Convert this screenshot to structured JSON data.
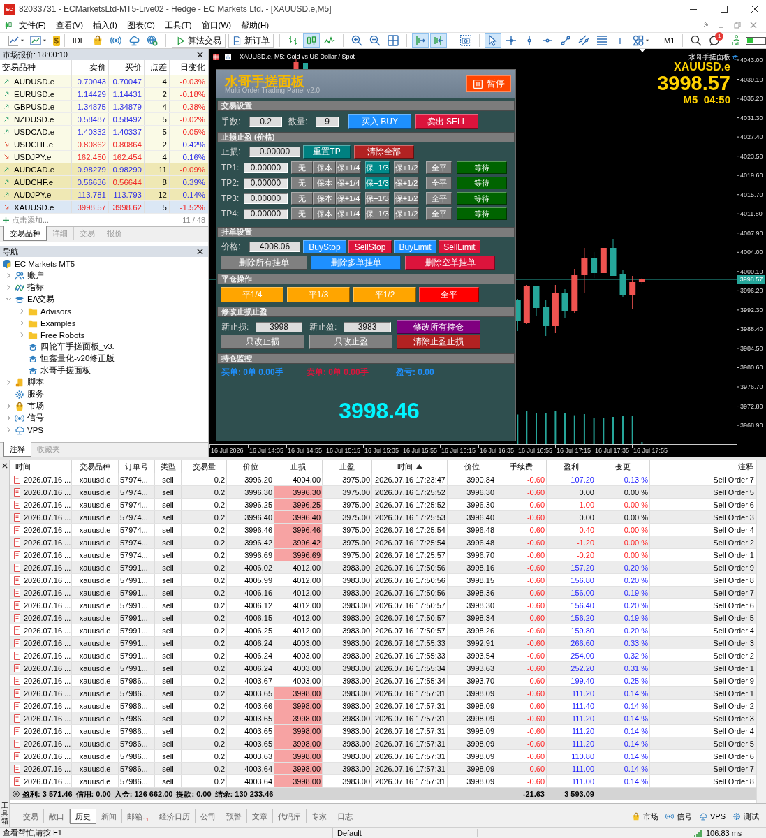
{
  "window": {
    "icon_label": "EC",
    "title": "82033731 - ECMarketsLtd-MT5-Live02 - Hedge - EC Markets Ltd. - [XAUUSD.e,M5]"
  },
  "menu": [
    "文件(F)",
    "查看(V)",
    "插入(I)",
    "图表(C)",
    "工具(T)",
    "窗口(W)",
    "帮助(H)"
  ],
  "toolbar": {
    "dollar": "$",
    "ide": "IDE",
    "algo_trading": "算法交易",
    "new_order": "新订单",
    "chart_types": [
      {
        "selected": false
      },
      {
        "selected": true
      },
      {
        "selected": false
      }
    ],
    "view_toggles": [
      {
        "on": true
      },
      {
        "on": true
      }
    ],
    "tools": [
      {
        "selected": true
      },
      {
        "selected": false
      },
      {
        "selected": false
      },
      {
        "selected": false
      },
      {
        "selected": false
      },
      {
        "selected": false
      },
      {
        "selected": false
      },
      {
        "label": "T",
        "selected": false
      },
      {
        "selected": false
      }
    ],
    "timeframe": "M1",
    "notifications": "1",
    "level_label": "LVL",
    "meter": {
      "level": 0.35
    }
  },
  "market_watch": {
    "title": "市场报价: 18:00:10",
    "columns": [
      "交易品种",
      "卖价",
      "买价",
      "点差",
      "日变化"
    ],
    "rows": [
      {
        "rising": true,
        "symbol": "AUDUSD.e",
        "bid": "0.70043",
        "bid_rising": true,
        "ask": "0.70047",
        "ask_rising": true,
        "spread": "4",
        "change": "-0.03%",
        "change_rising": false,
        "highlighted": false,
        "selected": false
      },
      {
        "rising": true,
        "symbol": "EURUSD.e",
        "bid": "1.14429",
        "bid_rising": true,
        "ask": "1.14431",
        "ask_rising": true,
        "spread": "2",
        "change": "-0.18%",
        "change_rising": false,
        "highlighted": false,
        "selected": false
      },
      {
        "rising": true,
        "symbol": "GBPUSD.e",
        "bid": "1.34875",
        "bid_rising": true,
        "ask": "1.34879",
        "ask_rising": true,
        "spread": "4",
        "change": "-0.38%",
        "change_rising": false,
        "highlighted": false,
        "selected": false
      },
      {
        "rising": true,
        "symbol": "NZDUSD.e",
        "bid": "0.58487",
        "bid_rising": true,
        "ask": "0.58492",
        "ask_rising": true,
        "spread": "5",
        "change": "-0.02%",
        "change_rising": false,
        "highlighted": false,
        "selected": false
      },
      {
        "rising": true,
        "symbol": "USDCAD.e",
        "bid": "1.40332",
        "bid_rising": true,
        "ask": "1.40337",
        "ask_rising": true,
        "spread": "5",
        "change": "-0.05%",
        "change_rising": false,
        "highlighted": false,
        "selected": false
      },
      {
        "rising": false,
        "symbol": "USDCHF.e",
        "bid": "0.80862",
        "bid_rising": false,
        "ask": "0.80864",
        "ask_rising": false,
        "spread": "2",
        "change": "0.42%",
        "change_rising": true,
        "highlighted": false,
        "selected": false
      },
      {
        "rising": false,
        "symbol": "USDJPY.e",
        "bid": "162.450",
        "bid_rising": false,
        "ask": "162.454",
        "ask_rising": false,
        "spread": "4",
        "change": "0.16%",
        "change_rising": true,
        "highlighted": false,
        "selected": false
      },
      {
        "rising": true,
        "symbol": "AUDCAD.e",
        "bid": "0.98279",
        "bid_rising": true,
        "ask": "0.98290",
        "ask_rising": true,
        "spread": "11",
        "change": "-0.09%",
        "change_rising": false,
        "highlighted": true,
        "selected": false
      },
      {
        "rising": true,
        "symbol": "AUDCHF.e",
        "bid": "0.56636",
        "bid_rising": true,
        "ask": "0.56644",
        "ask_rising": false,
        "spread": "8",
        "change": "0.39%",
        "change_rising": true,
        "highlighted": true,
        "selected": false
      },
      {
        "rising": true,
        "symbol": "AUDJPY.e",
        "bid": "113.781",
        "bid_rising": true,
        "ask": "113.793",
        "ask_rising": true,
        "spread": "12",
        "change": "0.14%",
        "change_rising": true,
        "highlighted": true,
        "selected": false
      },
      {
        "rising": false,
        "symbol": "XAUUSD.e",
        "bid": "3998.57",
        "bid_rising": false,
        "ask": "3998.62",
        "ask_rising": false,
        "spread": "5",
        "change": "-1.52%",
        "change_rising": false,
        "highlighted": false,
        "selected": true
      }
    ],
    "add_label": "点击添加...",
    "count": "11 / 48",
    "tabs": [
      {
        "label": "交易品种",
        "selected": true
      },
      {
        "label": "详细",
        "selected": false
      },
      {
        "label": "交易",
        "selected": false
      },
      {
        "label": "报价",
        "selected": false
      }
    ]
  },
  "navigator": {
    "title": "导航",
    "tree": [
      {
        "label": "EC Markets MT5",
        "kind": "broker",
        "children": [
          {
            "label": "账户",
            "kind": "accounts",
            "expanded": false
          },
          {
            "label": "指标",
            "kind": "indicators",
            "expanded": false
          },
          {
            "label": "EA交易",
            "kind": "experts",
            "expanded": true,
            "children": [
              {
                "label": "Advisors",
                "kind": "folder",
                "expanded": false
              },
              {
                "label": "Examples",
                "kind": "folder",
                "expanded": false
              },
              {
                "label": "Free Robots",
                "kind": "folder",
                "expanded": false
              },
              {
                "label": "四轮车手搓面板_v3.",
                "kind": "expert"
              },
              {
                "label": "恒鑫量化-v20修正版",
                "kind": "expert"
              },
              {
                "label": "水哥手搓面板",
                "kind": "expert"
              }
            ]
          },
          {
            "label": "脚本",
            "kind": "scripts",
            "expanded": false
          },
          {
            "label": "服务",
            "kind": "services"
          },
          {
            "label": "市场",
            "kind": "market",
            "expanded": false
          },
          {
            "label": "信号",
            "kind": "signals",
            "expanded": false
          },
          {
            "label": "VPS",
            "kind": "vps",
            "expanded": false
          }
        ]
      }
    ],
    "tabs": [
      {
        "label": "注释",
        "selected": true
      },
      {
        "label": "收藏夹",
        "selected": false
      }
    ]
  },
  "chart": {
    "symbol_line": "XAUUSD.e, M5: Gold vs US Dollar / Spot",
    "overlay": {
      "caption": "水哥手搓面板",
      "symbol": "XAUUSD.e",
      "price": "3998.57",
      "timer": "M5  04:50"
    },
    "price_axis": [
      "4043.00",
      "4039.10",
      "4035.20",
      "4031.30",
      "4027.40",
      "4023.50",
      "4019.60",
      "4015.70",
      "4011.80",
      "4007.90",
      "4004.00",
      "4000.10",
      "3996.20",
      "3992.30",
      "3988.40",
      "3984.50",
      "3980.60",
      "3976.70",
      "3972.80",
      "3968.90"
    ],
    "current_price": "3998.57",
    "time_axis": [
      "16 Jul 2026",
      "16 Jul 14:35",
      "16 Jul 14:55",
      "16 Jul 15:15",
      "16 Jul 15:35",
      "16 Jul 15:55",
      "16 Jul 16:15",
      "16 Jul 16:35",
      "16 Jul 16:55",
      "16 Jul 17:15",
      "16 Jul 17:35",
      "16 Jul 17:55"
    ]
  },
  "panel": {
    "title": "水哥手搓面板",
    "subtitle": "Multi-Order Trading Panel v2.0",
    "pause_button": {
      "label": "暂停",
      "color": "#ff4500"
    },
    "trade": {
      "title": "交易设置",
      "lots_label": "手数:",
      "lots": "0.2",
      "count_label": "数量:",
      "count": "9",
      "buttons": [
        {
          "label": "买入 BUY",
          "color": "#1e90ff"
        },
        {
          "label": "卖出 SELL",
          "color": "#dc143c"
        }
      ]
    },
    "sl_tp": {
      "title": "止损止盈 (价格)",
      "sl_label": "止损:",
      "sl": "0.00000",
      "buttons": [
        {
          "label": "重置TP",
          "color": "#008080"
        },
        {
          "label": "清除全部",
          "color": "#b22222"
        }
      ],
      "levels": [
        {
          "label": "TP1:",
          "value": "0.00000",
          "options": [
            {
              "label": "无",
              "selected": false
            },
            {
              "label": "保本",
              "selected": false
            },
            {
              "label": "保+1/4",
              "selected": false
            },
            {
              "label": "保+1/3",
              "selected": true
            },
            {
              "label": "保+1/2",
              "selected": false
            }
          ],
          "close_button": {
            "label": "全平",
            "color": "#808080"
          },
          "status_button": {
            "label": "等待",
            "color": "#006400"
          }
        },
        {
          "label": "TP2:",
          "value": "0.00000",
          "options": [
            {
              "label": "无",
              "selected": false
            },
            {
              "label": "保本",
              "selected": false
            },
            {
              "label": "保+1/4",
              "selected": false
            },
            {
              "label": "保+1/3",
              "selected": true
            },
            {
              "label": "保+1/2",
              "selected": false
            }
          ],
          "close_button": {
            "label": "全平",
            "color": "#808080"
          },
          "status_button": {
            "label": "等待",
            "color": "#006400"
          }
        },
        {
          "label": "TP3:",
          "value": "0.00000",
          "options": [
            {
              "label": "无",
              "selected": false
            },
            {
              "label": "保本",
              "selected": false
            },
            {
              "label": "保+1/4",
              "selected": false
            },
            {
              "label": "保+1/3",
              "selected": false
            },
            {
              "label": "保+1/2",
              "selected": false
            }
          ],
          "close_button": {
            "label": "全平",
            "color": "#808080"
          },
          "status_button": {
            "label": "等待",
            "color": "#006400"
          }
        },
        {
          "label": "TP4:",
          "value": "0.00000",
          "options": [
            {
              "label": "无",
              "selected": false
            },
            {
              "label": "保本",
              "selected": false
            },
            {
              "label": "保+1/4",
              "selected": false
            },
            {
              "label": "保+1/3",
              "selected": false
            },
            {
              "label": "保+1/2",
              "selected": false
            }
          ],
          "close_button": {
            "label": "全平",
            "color": "#808080"
          },
          "status_button": {
            "label": "等待",
            "color": "#006400"
          }
        }
      ]
    },
    "pending": {
      "title": "挂单设置",
      "price_label": "价格:",
      "price": "4008.06",
      "order_buttons": [
        {
          "label": "BuyStop",
          "color": "#1e90ff"
        },
        {
          "label": "SellStop",
          "color": "#dc143c"
        },
        {
          "label": "BuyLimit",
          "color": "#1e90ff"
        },
        {
          "label": "SellLimit",
          "color": "#dc143c"
        }
      ],
      "delete_buttons": [
        {
          "label": "删除所有挂单",
          "color": "#808080"
        },
        {
          "label": "删除多单挂单",
          "color": "#1e90ff"
        },
        {
          "label": "删除空单挂单",
          "color": "#dc143c"
        }
      ]
    },
    "close": {
      "title": "平仓操作",
      "buttons": [
        {
          "label": "平1/4",
          "color": "#ffa500"
        },
        {
          "label": "平1/3",
          "color": "#ffa500"
        },
        {
          "label": "平1/2",
          "color": "#ffa500"
        },
        {
          "label": "全平",
          "color": "#ff0000"
        }
      ]
    },
    "modify": {
      "title": "修改止损止盈",
      "sl_label": "新止损:",
      "sl": "3998",
      "tp_label": "新止盈:",
      "tp": "3983",
      "buttons": [
        {
          "label": "修改所有持仓",
          "color": "#800080"
        },
        {
          "label": "只改止损",
          "color": "#808080"
        },
        {
          "label": "只改止盈",
          "color": "#808080"
        },
        {
          "label": "清除止盈止损",
          "color": "#b22222"
        }
      ]
    },
    "monitor": {
      "title": "持仓监控",
      "stats": [
        {
          "text": "买单: 0单 0.00手",
          "color": "#1e90ff"
        },
        {
          "text": "卖单: 0单 0.00手",
          "color": "#dc143c"
        },
        {
          "text": "盈亏: 0.00",
          "color": "#1e90ff"
        }
      ],
      "price": "3998.46"
    }
  },
  "trades": {
    "columns": [
      {
        "label": "时间",
        "sorted": false
      },
      {
        "label": "交易品种",
        "sorted": false
      },
      {
        "label": "订单号",
        "sorted": false
      },
      {
        "label": "类型",
        "sorted": false
      },
      {
        "label": "交易量",
        "sorted": false
      },
      {
        "label": "价位",
        "sorted": false
      },
      {
        "label": "止损",
        "sorted": false
      },
      {
        "label": "止盈",
        "sorted": false
      },
      {
        "label": "时间",
        "sorted": true
      },
      {
        "label": "价位",
        "sorted": false
      },
      {
        "label": "手续费",
        "sorted": false
      },
      {
        "label": "盈利",
        "sorted": false
      },
      {
        "label": "变更",
        "sorted": false
      },
      {
        "label": "注释",
        "sorted": false
      }
    ],
    "rows": [
      {
        "cells": [
          "2026.07.16 ...",
          "xauusd.e",
          "57974...",
          "sell",
          "0.2",
          "3996.20",
          "4004.00",
          "3975.00",
          "2026.07.16 17:23:47",
          "3990.84",
          "-0.60",
          "107.20",
          "0.13 %",
          "Sell Order 7"
        ],
        "sl_alert": false,
        "kind": "gain"
      },
      {
        "cells": [
          "2026.07.16 ...",
          "xauusd.e",
          "57974...",
          "sell",
          "0.2",
          "3996.30",
          "3996.30",
          "3975.00",
          "2026.07.16 17:25:52",
          "3996.30",
          "-0.60",
          "0.00",
          "0.00 %",
          "Sell Order 5"
        ],
        "sl_alert": true,
        "kind": "even"
      },
      {
        "cells": [
          "2026.07.16 ...",
          "xauusd.e",
          "57974...",
          "sell",
          "0.2",
          "3996.25",
          "3996.25",
          "3975.00",
          "2026.07.16 17:25:52",
          "3996.30",
          "-0.60",
          "-1.00",
          "0.00 %",
          "Sell Order 6"
        ],
        "sl_alert": true,
        "kind": "loss"
      },
      {
        "cells": [
          "2026.07.16 ...",
          "xauusd.e",
          "57974...",
          "sell",
          "0.2",
          "3996.40",
          "3996.40",
          "3975.00",
          "2026.07.16 17:25:53",
          "3996.40",
          "-0.60",
          "0.00",
          "0.00 %",
          "Sell Order 3"
        ],
        "sl_alert": true,
        "kind": "even"
      },
      {
        "cells": [
          "2026.07.16 ...",
          "xauusd.e",
          "57974...",
          "sell",
          "0.2",
          "3996.46",
          "3996.46",
          "3975.00",
          "2026.07.16 17:25:54",
          "3996.48",
          "-0.60",
          "-0.40",
          "0.00 %",
          "Sell Order 4"
        ],
        "sl_alert": true,
        "kind": "loss"
      },
      {
        "cells": [
          "2026.07.16 ...",
          "xauusd.e",
          "57974...",
          "sell",
          "0.2",
          "3996.42",
          "3996.42",
          "3975.00",
          "2026.07.16 17:25:54",
          "3996.48",
          "-0.60",
          "-1.20",
          "0.00 %",
          "Sell Order 2"
        ],
        "sl_alert": true,
        "kind": "loss"
      },
      {
        "cells": [
          "2026.07.16 ...",
          "xauusd.e",
          "57974...",
          "sell",
          "0.2",
          "3996.69",
          "3996.69",
          "3975.00",
          "2026.07.16 17:25:57",
          "3996.70",
          "-0.60",
          "-0.20",
          "0.00 %",
          "Sell Order 1"
        ],
        "sl_alert": true,
        "kind": "loss"
      },
      {
        "cells": [
          "2026.07.16 ...",
          "xauusd.e",
          "57991...",
          "sell",
          "0.2",
          "4006.02",
          "4012.00",
          "3983.00",
          "2026.07.16 17:50:56",
          "3998.16",
          "-0.60",
          "157.20",
          "0.20 %",
          "Sell Order 9"
        ],
        "sl_alert": false,
        "kind": "gain"
      },
      {
        "cells": [
          "2026.07.16 ...",
          "xauusd.e",
          "57991...",
          "sell",
          "0.2",
          "4005.99",
          "4012.00",
          "3983.00",
          "2026.07.16 17:50:56",
          "3998.15",
          "-0.60",
          "156.80",
          "0.20 %",
          "Sell Order 8"
        ],
        "sl_alert": false,
        "kind": "gain"
      },
      {
        "cells": [
          "2026.07.16 ...",
          "xauusd.e",
          "57991...",
          "sell",
          "0.2",
          "4006.16",
          "4012.00",
          "3983.00",
          "2026.07.16 17:50:56",
          "3998.36",
          "-0.60",
          "156.00",
          "0.19 %",
          "Sell Order 7"
        ],
        "sl_alert": false,
        "kind": "gain"
      },
      {
        "cells": [
          "2026.07.16 ...",
          "xauusd.e",
          "57991...",
          "sell",
          "0.2",
          "4006.12",
          "4012.00",
          "3983.00",
          "2026.07.16 17:50:57",
          "3998.30",
          "-0.60",
          "156.40",
          "0.20 %",
          "Sell Order 6"
        ],
        "sl_alert": false,
        "kind": "gain"
      },
      {
        "cells": [
          "2026.07.16 ...",
          "xauusd.e",
          "57991...",
          "sell",
          "0.2",
          "4006.15",
          "4012.00",
          "3983.00",
          "2026.07.16 17:50:57",
          "3998.34",
          "-0.60",
          "156.20",
          "0.19 %",
          "Sell Order 5"
        ],
        "sl_alert": false,
        "kind": "gain"
      },
      {
        "cells": [
          "2026.07.16 ...",
          "xauusd.e",
          "57991...",
          "sell",
          "0.2",
          "4006.25",
          "4012.00",
          "3983.00",
          "2026.07.16 17:50:57",
          "3998.26",
          "-0.60",
          "159.80",
          "0.20 %",
          "Sell Order 4"
        ],
        "sl_alert": false,
        "kind": "gain"
      },
      {
        "cells": [
          "2026.07.16 ...",
          "xauusd.e",
          "57991...",
          "sell",
          "0.2",
          "4006.24",
          "4003.00",
          "3983.00",
          "2026.07.16 17:55:33",
          "3992.91",
          "-0.60",
          "266.60",
          "0.33 %",
          "Sell Order 3"
        ],
        "sl_alert": false,
        "kind": "gain"
      },
      {
        "cells": [
          "2026.07.16 ...",
          "xauusd.e",
          "57991...",
          "sell",
          "0.2",
          "4006.24",
          "4003.00",
          "3983.00",
          "2026.07.16 17:55:33",
          "3993.54",
          "-0.60",
          "254.00",
          "0.32 %",
          "Sell Order 2"
        ],
        "sl_alert": false,
        "kind": "gain"
      },
      {
        "cells": [
          "2026.07.16 ...",
          "xauusd.e",
          "57991...",
          "sell",
          "0.2",
          "4006.24",
          "4003.00",
          "3983.00",
          "2026.07.16 17:55:34",
          "3993.63",
          "-0.60",
          "252.20",
          "0.31 %",
          "Sell Order 1"
        ],
        "sl_alert": false,
        "kind": "gain"
      },
      {
        "cells": [
          "2026.07.16 ...",
          "xauusd.e",
          "57986...",
          "sell",
          "0.2",
          "4003.67",
          "4003.00",
          "3983.00",
          "2026.07.16 17:55:34",
          "3993.70",
          "-0.60",
          "199.40",
          "0.25 %",
          "Sell Order 9"
        ],
        "sl_alert": false,
        "kind": "gain"
      },
      {
        "cells": [
          "2026.07.16 ...",
          "xauusd.e",
          "57986...",
          "sell",
          "0.2",
          "4003.65",
          "3998.00",
          "3983.00",
          "2026.07.16 17:57:31",
          "3998.09",
          "-0.60",
          "111.20",
          "0.14 %",
          "Sell Order 1"
        ],
        "sl_alert": true,
        "kind": "gain"
      },
      {
        "cells": [
          "2026.07.16 ...",
          "xauusd.e",
          "57986...",
          "sell",
          "0.2",
          "4003.66",
          "3998.00",
          "3983.00",
          "2026.07.16 17:57:31",
          "3998.09",
          "-0.60",
          "111.40",
          "0.14 %",
          "Sell Order 2"
        ],
        "sl_alert": true,
        "kind": "gain"
      },
      {
        "cells": [
          "2026.07.16 ...",
          "xauusd.e",
          "57986...",
          "sell",
          "0.2",
          "4003.65",
          "3998.00",
          "3983.00",
          "2026.07.16 17:57:31",
          "3998.09",
          "-0.60",
          "111.20",
          "0.14 %",
          "Sell Order 3"
        ],
        "sl_alert": true,
        "kind": "gain"
      },
      {
        "cells": [
          "2026.07.16 ...",
          "xauusd.e",
          "57986...",
          "sell",
          "0.2",
          "4003.65",
          "3998.00",
          "3983.00",
          "2026.07.16 17:57:31",
          "3998.09",
          "-0.60",
          "111.20",
          "0.14 %",
          "Sell Order 4"
        ],
        "sl_alert": true,
        "kind": "gain"
      },
      {
        "cells": [
          "2026.07.16 ...",
          "xauusd.e",
          "57986...",
          "sell",
          "0.2",
          "4003.65",
          "3998.00",
          "3983.00",
          "2026.07.16 17:57:31",
          "3998.09",
          "-0.60",
          "111.20",
          "0.14 %",
          "Sell Order 5"
        ],
        "sl_alert": true,
        "kind": "gain"
      },
      {
        "cells": [
          "2026.07.16 ...",
          "xauusd.e",
          "57986...",
          "sell",
          "0.2",
          "4003.63",
          "3998.00",
          "3983.00",
          "2026.07.16 17:57:31",
          "3998.09",
          "-0.60",
          "110.80",
          "0.14 %",
          "Sell Order 6"
        ],
        "sl_alert": true,
        "kind": "gain"
      },
      {
        "cells": [
          "2026.07.16 ...",
          "xauusd.e",
          "57986...",
          "sell",
          "0.2",
          "4003.64",
          "3998.00",
          "3983.00",
          "2026.07.16 17:57:31",
          "3998.09",
          "-0.60",
          "111.00",
          "0.14 %",
          "Sell Order 7"
        ],
        "sl_alert": true,
        "kind": "gain"
      },
      {
        "cells": [
          "2026.07.16 ...",
          "xauusd.e",
          "57986...",
          "sell",
          "0.2",
          "4003.64",
          "3998.00",
          "3983.00",
          "2026.07.16 17:57:31",
          "3998.09",
          "-0.60",
          "111.00",
          "0.14 %",
          "Sell Order 8"
        ],
        "sl_alert": true,
        "kind": "gain"
      }
    ],
    "summary": {
      "totals": [
        "盈利: 3 571.46",
        "信用: 0.00",
        "入金: 126 662.00",
        "提款: 0.00",
        "结余: 130 233.46"
      ],
      "commission": "-21.63",
      "profit": "3 593.09"
    }
  },
  "toolbox": {
    "label": "工具箱",
    "tabs": [
      {
        "label": "交易",
        "selected": false
      },
      {
        "label": "敞口",
        "selected": false
      },
      {
        "label": "历史",
        "selected": true
      },
      {
        "label": "新闻",
        "selected": false
      },
      {
        "label": "邮箱",
        "badge": "11",
        "selected": false
      },
      {
        "label": "经济日历",
        "selected": false
      },
      {
        "label": "公司",
        "selected": false
      },
      {
        "label": "预警",
        "selected": false
      },
      {
        "label": "文章",
        "selected": false
      },
      {
        "label": "代码库",
        "selected": false
      },
      {
        "label": "专家",
        "selected": false
      },
      {
        "label": "日志",
        "selected": false
      }
    ],
    "services": [
      "市场",
      "信号",
      "VPS",
      "测试"
    ]
  },
  "status_bar": {
    "help": "查看帮忙,请按 F1",
    "profile": "Default",
    "ping": "106.83 ms"
  }
}
